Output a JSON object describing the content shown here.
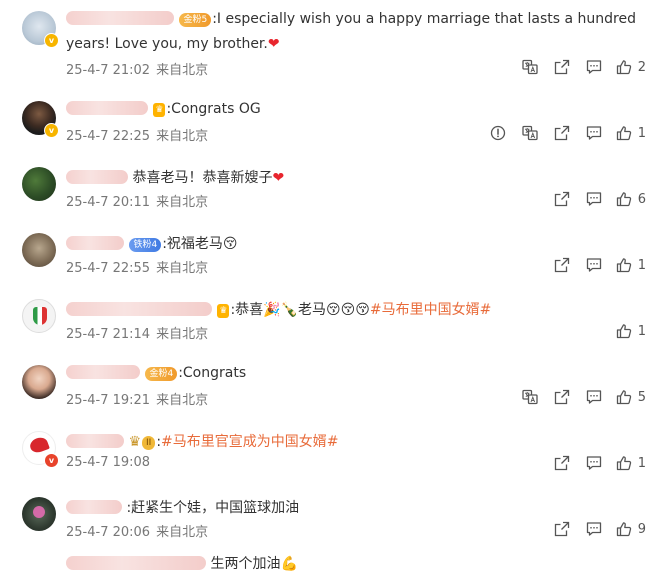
{
  "comments": [
    {
      "text": ":I especially wish you a happy marriage that lasts a hundred",
      "text2": "years! Love you, my brother.",
      "emoji_end": "❤",
      "badge": "金粉5",
      "date": "25-4-7 21:02",
      "location": "来自北京",
      "likes": "2"
    },
    {
      "text": ":Congrats OG",
      "date": "25-4-7 22:25",
      "location": "来自北京",
      "likes": "1"
    },
    {
      "text": "恭喜老马！恭喜新嫂子",
      "emoji_end": "❤",
      "date": "25-4-7 20:11",
      "location": "来自北京",
      "likes": "6"
    },
    {
      "text": ":祝福老马",
      "emoji_end": "😚",
      "badge": "铁粉4",
      "date": "25-4-7 22:55",
      "location": "来自北京",
      "likes": "1"
    },
    {
      "text": ":恭喜",
      "text_mid": "老马",
      "emoji_mid": "🎉🍾",
      "emoji_end": "😚😚😚",
      "hashtag": "#马布里中国女婿#",
      "date": "25-4-7 21:14",
      "location": "来自北京",
      "likes": "1"
    },
    {
      "text": ":Congrats",
      "badge": "金粉4",
      "date": "25-4-7 19:21",
      "location": "来自北京",
      "likes": "5"
    },
    {
      "text": ":",
      "hashtag": "#马布里官宣成为中国女婿#",
      "badge": "II",
      "date": "25-4-7 19:08",
      "likes": "1"
    },
    {
      "text": ":赶紧生个娃，中国篮球加油",
      "date": "25-4-7 20:06",
      "location": "来自北京",
      "likes": "9"
    },
    {
      "text": "生两个加油",
      "emoji_end": "💪"
    }
  ],
  "icons": {
    "translate": "translate-icon",
    "report": "report-icon",
    "share": "share-icon",
    "reply": "comment-icon",
    "like": "thumbs-up-icon"
  }
}
